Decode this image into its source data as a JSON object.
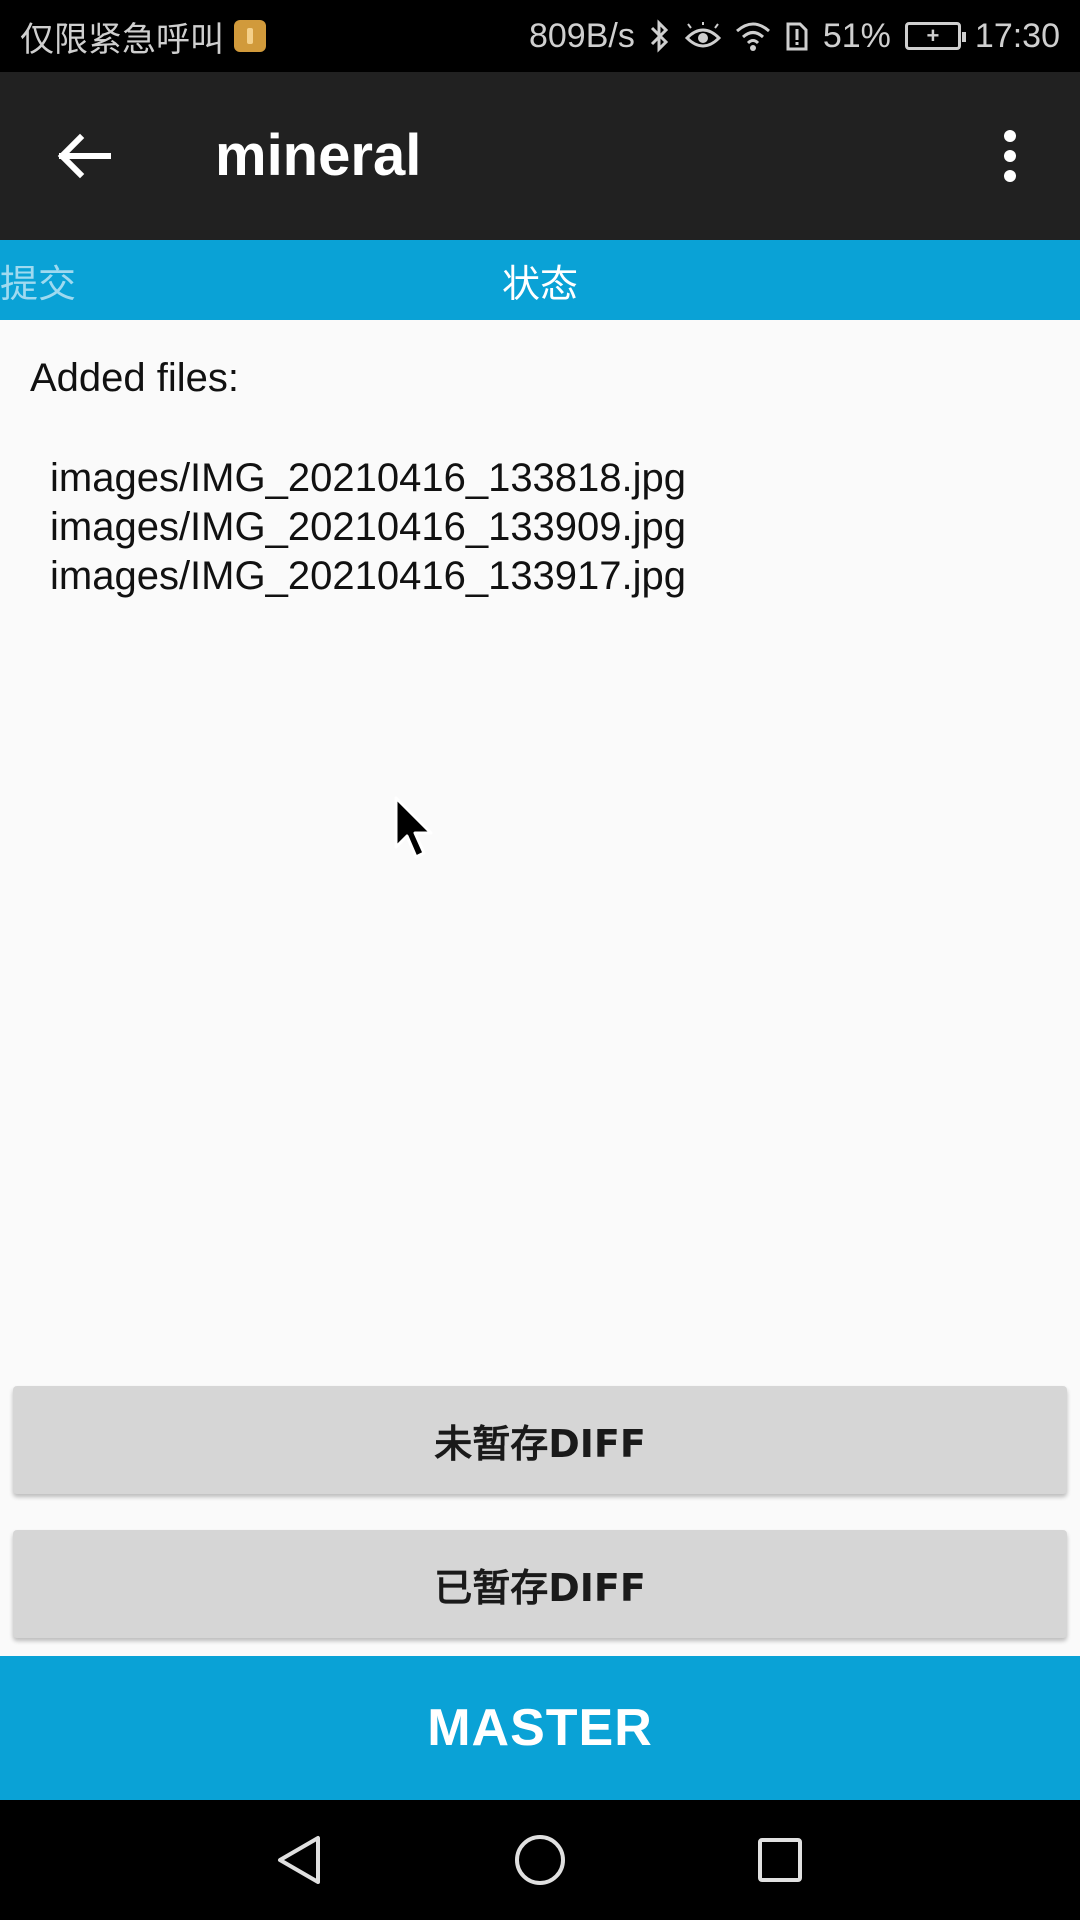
{
  "status_bar": {
    "carrier_text": "仅限紧急呼叫",
    "net_speed": "809B/s",
    "battery_percent": "51%",
    "time": "17:30",
    "icons": [
      "sim-icon",
      "bluetooth-icon",
      "eye-icon",
      "wifi-icon",
      "alert-icon",
      "battery-icon"
    ]
  },
  "app_bar": {
    "title": "mineral",
    "back_icon": "arrow-back-icon",
    "overflow_icon": "more-vertical-icon"
  },
  "tabs": [
    {
      "label": "提交",
      "selected": false
    },
    {
      "label": "状态",
      "selected": true
    }
  ],
  "content": {
    "section_label": "Added files:",
    "files": [
      "images/IMG_20210416_133818.jpg",
      "images/IMG_20210416_133909.jpg",
      "images/IMG_20210416_133917.jpg"
    ]
  },
  "buttons": {
    "unstaged_diff": "未暂存DIFF",
    "staged_diff": "已暂存DIFF"
  },
  "branch": {
    "label": "MASTER"
  },
  "colors": {
    "accent": "#0aa2d6",
    "app_bar": "#212121",
    "button_bg": "#d6d6d6"
  }
}
